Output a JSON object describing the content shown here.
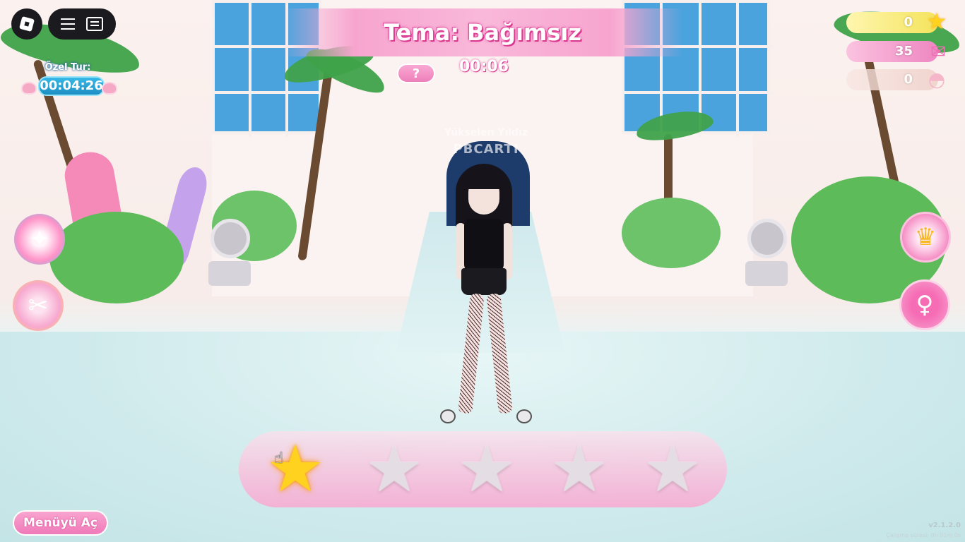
{
  "hud": {
    "theme_title": "Tema: Bağımsız",
    "round_timer": "00:06",
    "special_round_label": "Özel Tur:",
    "special_round_timer": "00:04:26",
    "open_menu_label": "Menüyü Aç",
    "version": "v2.1.2.0",
    "perf_text": "Çalışma süresi: 0h 01m 0s"
  },
  "player": {
    "title": "Yükselen Yıldız",
    "name": "PBCARTI"
  },
  "currencies": [
    {
      "name": "stars",
      "value": "0",
      "icon": "star-icon"
    },
    {
      "name": "tickets",
      "value": "35",
      "icon": "ticket-icon"
    },
    {
      "name": "shells",
      "value": "0",
      "icon": "shell-icon"
    }
  ],
  "rating": {
    "max": 5,
    "selected": 1,
    "stars": [
      {
        "state": "selected"
      },
      {
        "state": "empty"
      },
      {
        "state": "empty"
      },
      {
        "state": "empty"
      },
      {
        "state": "empty"
      }
    ]
  },
  "side_buttons": {
    "left": [
      "pass-icon",
      "shop-icon"
    ],
    "right": [
      "trophy-icon",
      "pose-icon"
    ]
  },
  "colors": {
    "accent_pink": "#ef7ab9",
    "star_gold": "#ffd21f",
    "timer_blue": "#1d8fc4"
  }
}
